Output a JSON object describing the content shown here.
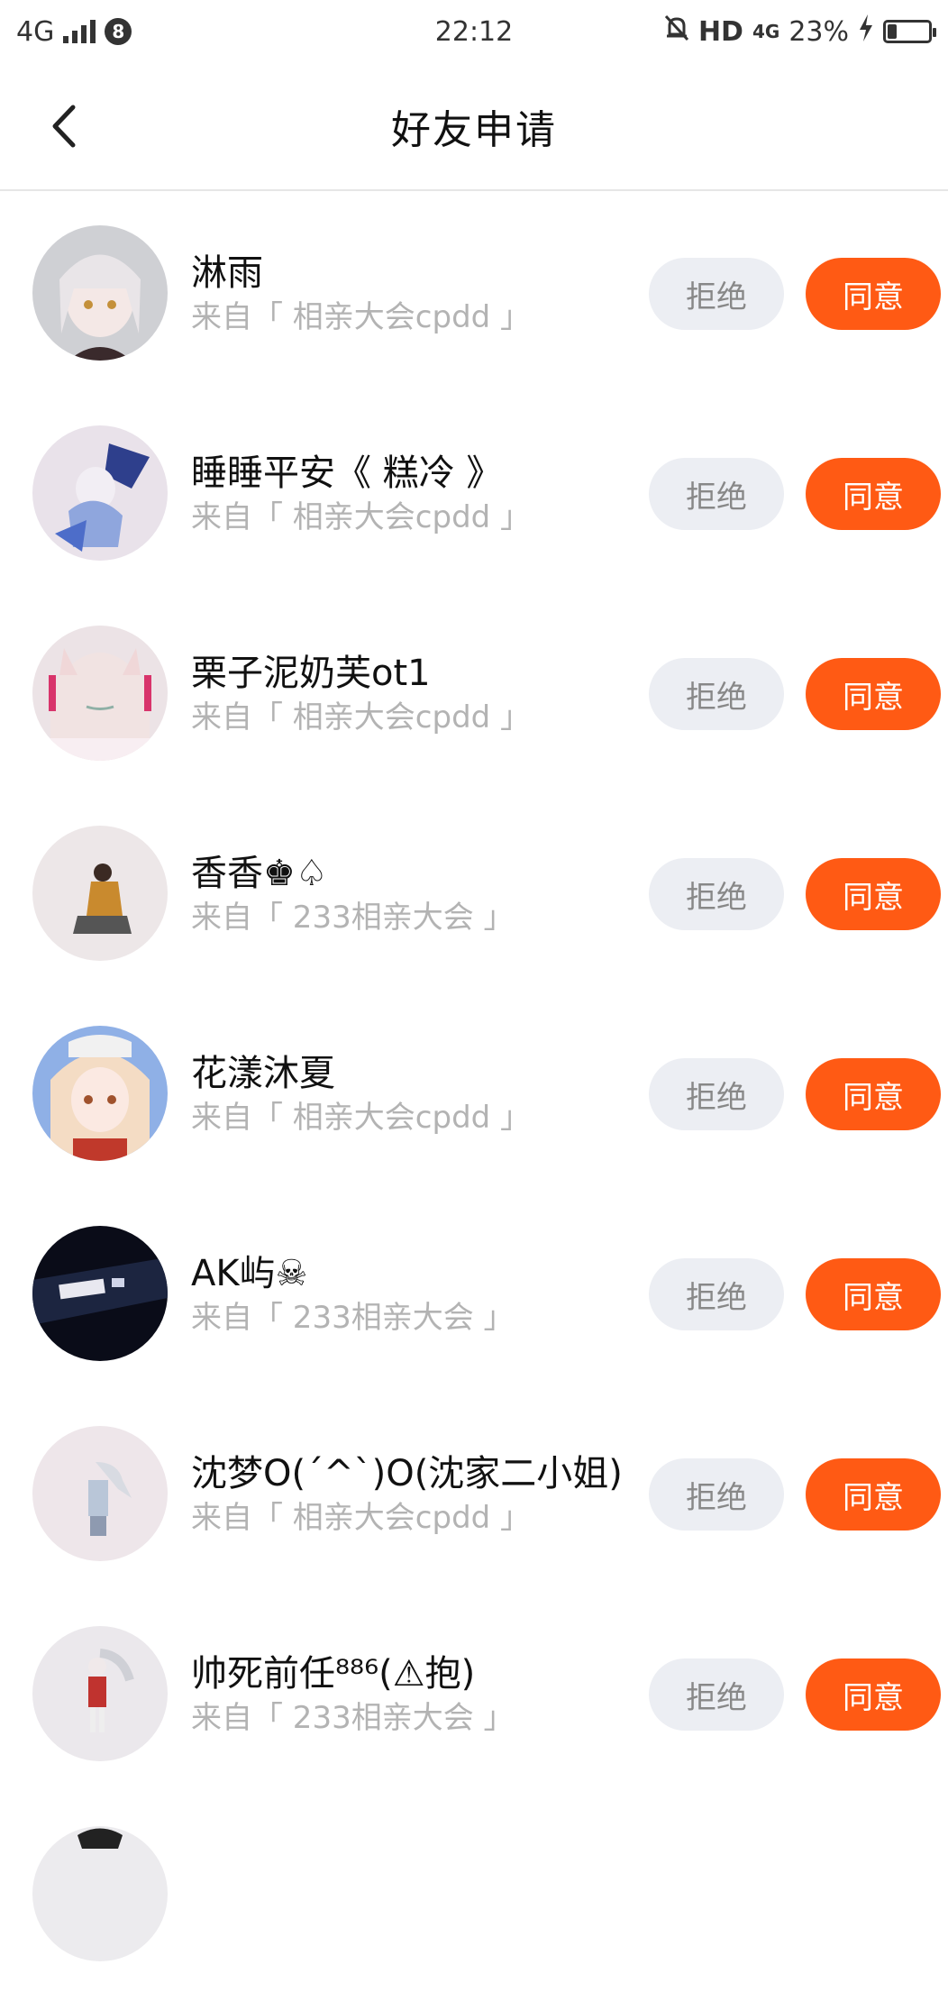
{
  "statusbar": {
    "network": "4G",
    "notif_count": "8",
    "time": "22:12",
    "hd": "HD",
    "data": "4G",
    "battery": "23%",
    "battery_level": 0.23
  },
  "header": {
    "title": "好友申请"
  },
  "buttons": {
    "reject": "拒绝",
    "accept": "同意"
  },
  "colors": {
    "accent": "#ff5a14",
    "reject_bg": "#eceef3",
    "sub_text": "#b3b3b3"
  },
  "requests": [
    {
      "name": "淋雨",
      "source": "来自「 相亲大会cpdd 」"
    },
    {
      "name": "睡睡平安《 糕冷 》",
      "source": "来自「 相亲大会cpdd 」"
    },
    {
      "name": "栗子泥奶芙ot1",
      "source": "来自「 相亲大会cpdd 」"
    },
    {
      "name": "香香♚♤",
      "source": "来自「 233相亲大会 」"
    },
    {
      "name": "花漾沐夏",
      "source": "来自「 相亲大会cpdd 」"
    },
    {
      "name": "AK屿☠",
      "source": "来自「 233相亲大会 」"
    },
    {
      "name": "沈梦O(´^`)O(沈家二小姐)",
      "source": "来自「 相亲大会cpdd 」"
    },
    {
      "name": "帅死前任⁸⁸⁶(⚠抱)",
      "source": "来自「 233相亲大会 」"
    }
  ]
}
